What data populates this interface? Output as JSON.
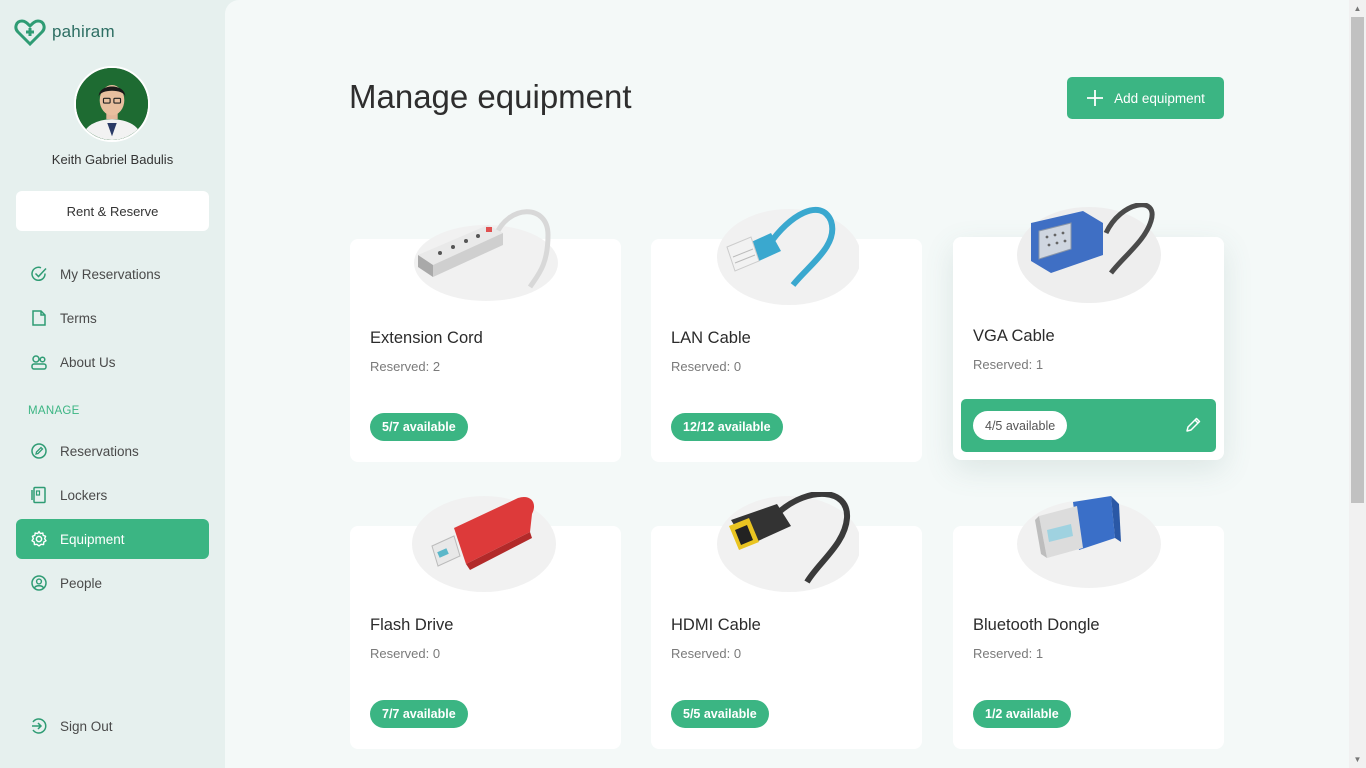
{
  "app": {
    "name": "pahiram"
  },
  "user": {
    "name": "Keith Gabriel Badulis"
  },
  "sidebar": {
    "rent_label": "Rent & Reserve",
    "items": [
      {
        "label": "My Reservations",
        "icon": "check-circle-icon"
      },
      {
        "label": "Terms",
        "icon": "document-icon"
      },
      {
        "label": "About Us",
        "icon": "people-icon"
      }
    ],
    "section_label": "MANAGE",
    "manage_items": [
      {
        "label": "Reservations",
        "icon": "pen-circle-icon"
      },
      {
        "label": "Lockers",
        "icon": "locker-icon"
      },
      {
        "label": "Equipment",
        "icon": "gear-icon",
        "active": true
      },
      {
        "label": "People",
        "icon": "person-icon"
      }
    ],
    "signout_label": "Sign Out"
  },
  "main": {
    "title": "Manage equipment",
    "add_label": "Add equipment",
    "equipment": [
      {
        "name": "Extension Cord",
        "reserved": "Reserved: 2",
        "available": "5/7 available",
        "icon": "extension-cord-icon"
      },
      {
        "name": "LAN Cable",
        "reserved": "Reserved: 0",
        "available": "12/12 available",
        "icon": "lan-cable-icon"
      },
      {
        "name": "VGA Cable",
        "reserved": "Reserved: 1",
        "available": "4/5 available",
        "icon": "vga-cable-icon",
        "hovered": true
      },
      {
        "name": "Flash Drive",
        "reserved": "Reserved: 0",
        "available": "7/7 available",
        "icon": "flash-drive-icon"
      },
      {
        "name": "HDMI Cable",
        "reserved": "Reserved: 0",
        "available": "5/5 available",
        "icon": "hdmi-cable-icon"
      },
      {
        "name": "Bluetooth Dongle",
        "reserved": "Reserved: 1",
        "available": "1/2 available",
        "icon": "bluetooth-dongle-icon"
      }
    ]
  },
  "colors": {
    "accent": "#3bb583",
    "sidebar_bg": "#e6f0ee",
    "main_bg": "#f4f9f8"
  }
}
